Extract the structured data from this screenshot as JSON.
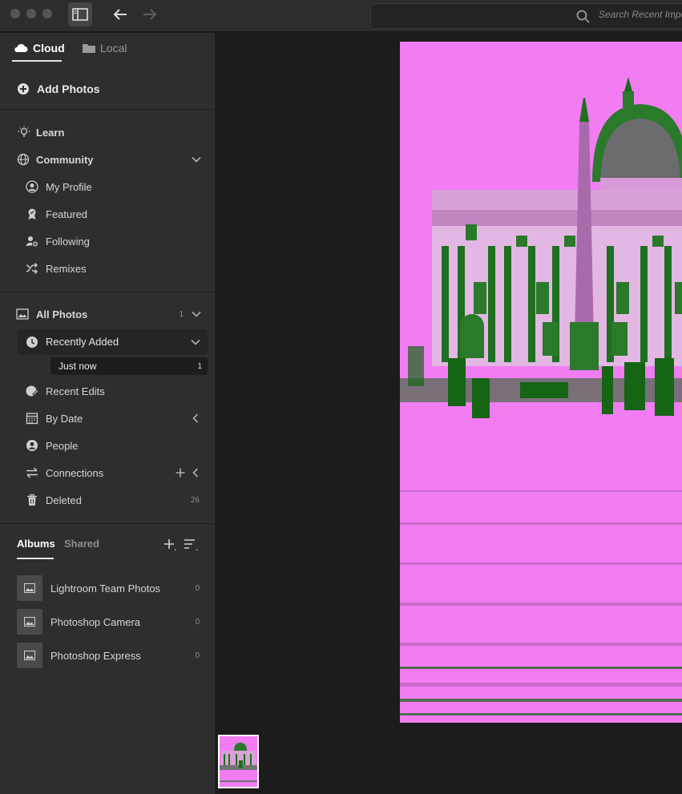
{
  "titlebar": {
    "search_placeholder": "Search Recent Imports"
  },
  "sidebar": {
    "tabs": {
      "cloud": "Cloud",
      "local": "Local"
    },
    "add_photos": "Add Photos",
    "learn": "Learn",
    "community": {
      "label": "Community",
      "items": [
        "My Profile",
        "Featured",
        "Following",
        "Remixes"
      ]
    },
    "all_photos": {
      "label": "All Photos",
      "count": "1"
    },
    "recently_added": {
      "label": "Recently Added",
      "sub_label": "Just now",
      "sub_count": "1"
    },
    "recent_edits": "Recent Edits",
    "by_date": "By Date",
    "people": "People",
    "connections": "Connections",
    "deleted": {
      "label": "Deleted",
      "count": "26"
    },
    "albums_tabs": {
      "albums": "Albums",
      "shared": "Shared"
    },
    "albums": [
      {
        "name": "Lightroom Team Photos",
        "count": "0"
      },
      {
        "name": "Photoshop Camera",
        "count": "0"
      },
      {
        "name": "Photoshop Express",
        "count": "0"
      }
    ]
  },
  "colors": {
    "photo_tint": "#f27cf2",
    "photo_shadow": "#0f6b0f"
  }
}
